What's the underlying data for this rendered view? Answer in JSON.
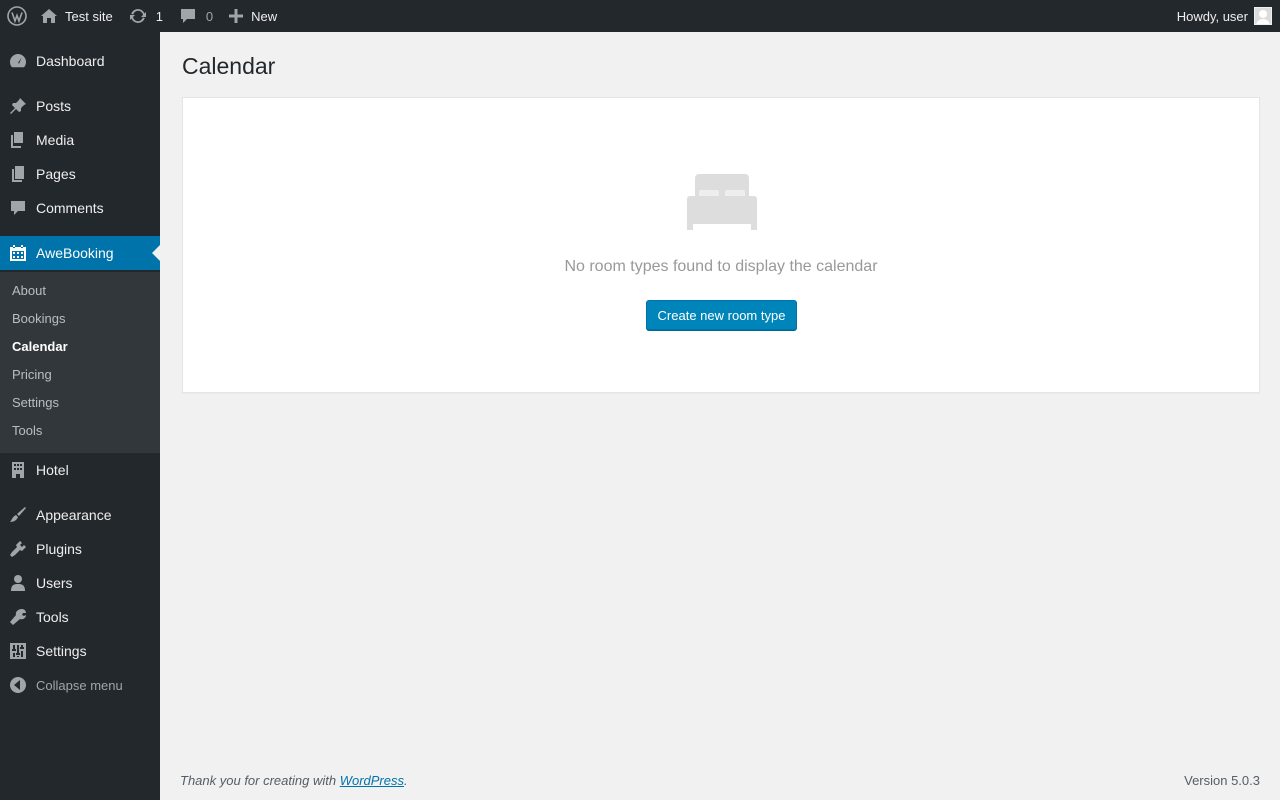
{
  "adminbar": {
    "site_name": "Test site",
    "updates_count": "1",
    "comments_count": "0",
    "new_label": "New",
    "greeting": "Howdy, user"
  },
  "sidebar": {
    "items": [
      {
        "label": "Dashboard",
        "icon": "dashboard-icon"
      },
      {
        "label": "Posts",
        "icon": "pin-icon"
      },
      {
        "label": "Media",
        "icon": "media-icon"
      },
      {
        "label": "Pages",
        "icon": "pages-icon"
      },
      {
        "label": "Comments",
        "icon": "comment-icon"
      },
      {
        "label": "AweBooking",
        "icon": "calendar-icon"
      },
      {
        "label": "Hotel",
        "icon": "building-icon"
      },
      {
        "label": "Appearance",
        "icon": "brush-icon"
      },
      {
        "label": "Plugins",
        "icon": "plugin-icon"
      },
      {
        "label": "Users",
        "icon": "user-icon"
      },
      {
        "label": "Tools",
        "icon": "wrench-icon"
      },
      {
        "label": "Settings",
        "icon": "sliders-icon"
      }
    ],
    "submenu": [
      "About",
      "Bookings",
      "Calendar",
      "Pricing",
      "Settings",
      "Tools"
    ],
    "collapse_label": "Collapse menu"
  },
  "main": {
    "title": "Calendar",
    "empty_message": "No room types found to display the calendar",
    "create_button": "Create new room type"
  },
  "footer": {
    "thanks_prefix": "Thank you for creating with ",
    "thanks_link": "WordPress",
    "thanks_suffix": ".",
    "version": "Version 5.0.3"
  },
  "colors": {
    "accent": "#0073aa",
    "sidebar_bg": "#23282d",
    "submenu_bg": "#32373c",
    "button_bg": "#0085ba"
  }
}
